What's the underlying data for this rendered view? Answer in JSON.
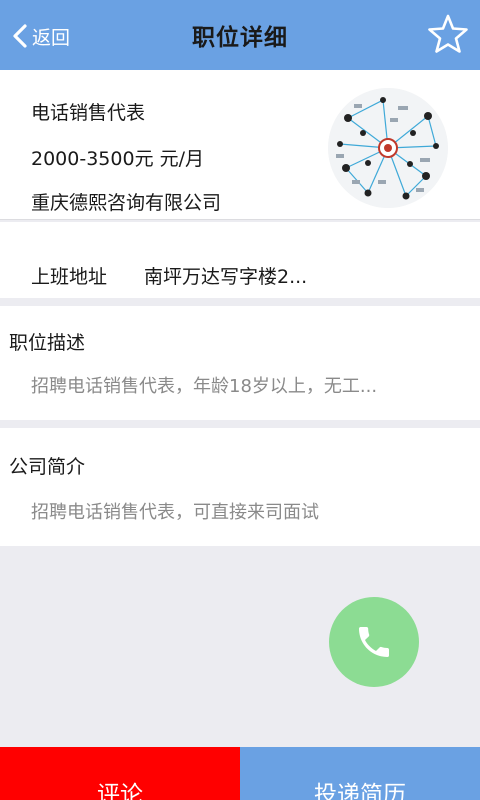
{
  "header": {
    "back_label": "返回",
    "title": "职位详细",
    "favorite_icon": "star-outline-icon"
  },
  "job": {
    "title": "电话销售代表",
    "salary": "2000-3500元 元/月",
    "company": "重庆德熙咨询有限公司"
  },
  "address": {
    "label": "上班地址",
    "value": "南坪万达写字楼2..."
  },
  "description": {
    "heading": "职位描述",
    "text": "招聘电话销售代表，年龄18岁以上，无工..."
  },
  "company_intro": {
    "heading": "公司简介",
    "text": "招聘电话销售代表，可直接来司面试"
  },
  "actions": {
    "call_icon": "phone-icon",
    "comment_label": "评论",
    "apply_label": "投递简历"
  },
  "colors": {
    "header_bg": "#6aa1e3",
    "comment_bg": "#ff0000",
    "apply_bg": "#6aa1e3",
    "call_bg": "#8cdc93",
    "page_bg": "#ececf1"
  }
}
